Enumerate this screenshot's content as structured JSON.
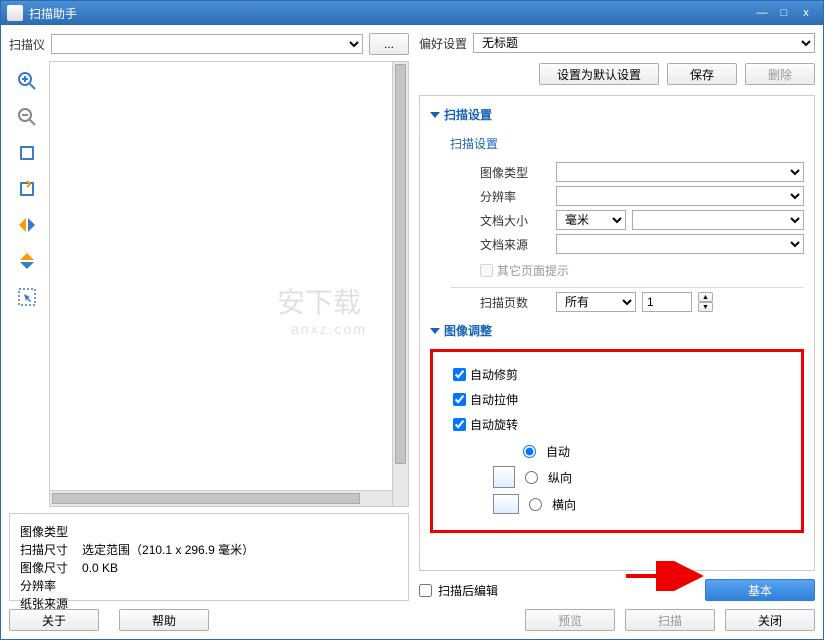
{
  "title": "扫描助手",
  "left": {
    "scanner_label": "扫描仪",
    "browse": "...",
    "about": "关于",
    "help": "帮助",
    "info": {
      "image_type_label": "图像类型",
      "scan_size_label": "扫描尺寸",
      "scan_size_value": "选定范围（210.1 x 296.9 毫米）",
      "image_size_label": "图像尺寸",
      "image_size_value": "0.0 KB",
      "resolution_label": "分辨率",
      "paper_source_label": "纸张来源"
    }
  },
  "right": {
    "pref_label": "偏好设置",
    "pref_value": "无标题",
    "set_default": "设置为默认设置",
    "save": "保存",
    "delete": "删除",
    "scan_settings": "扫描设置",
    "sub_scan_settings": "扫描设置",
    "image_type": "图像类型",
    "resolution": "分辨率",
    "doc_size": "文档大小",
    "doc_size_unit": "毫米",
    "doc_source": "文档来源",
    "other_page_hint": "其它页面提示",
    "page_count": "扫描页数",
    "page_count_mode": "所有",
    "page_count_value": "1",
    "image_adjust": "图像调整",
    "auto_crop": "自动修剪",
    "auto_stretch": "自动拉伸",
    "auto_rotate": "自动旋转",
    "orient_auto": "自动",
    "orient_portrait": "纵向",
    "orient_landscape": "横向",
    "edit_after_scan": "扫描后编辑",
    "basic": "基本",
    "preview": "预览",
    "scan": "扫描",
    "close": "关闭"
  }
}
